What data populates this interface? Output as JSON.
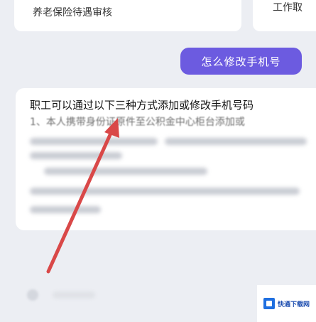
{
  "top_cards": {
    "left_label": "养老保险待遇审核",
    "right_label": "工作取"
  },
  "user_message": "怎么修改手机号",
  "answer": {
    "title": "职工可以通过以下三种方式添加或修改手机号码",
    "step1": "1、本人携带身份证原件至公积金中心柜台添加或"
  },
  "watermark": {
    "text": "快通下载网"
  },
  "colors": {
    "accent": "#6c5be0",
    "arrow": "#d94848",
    "watermark": "#1f6fe0"
  }
}
